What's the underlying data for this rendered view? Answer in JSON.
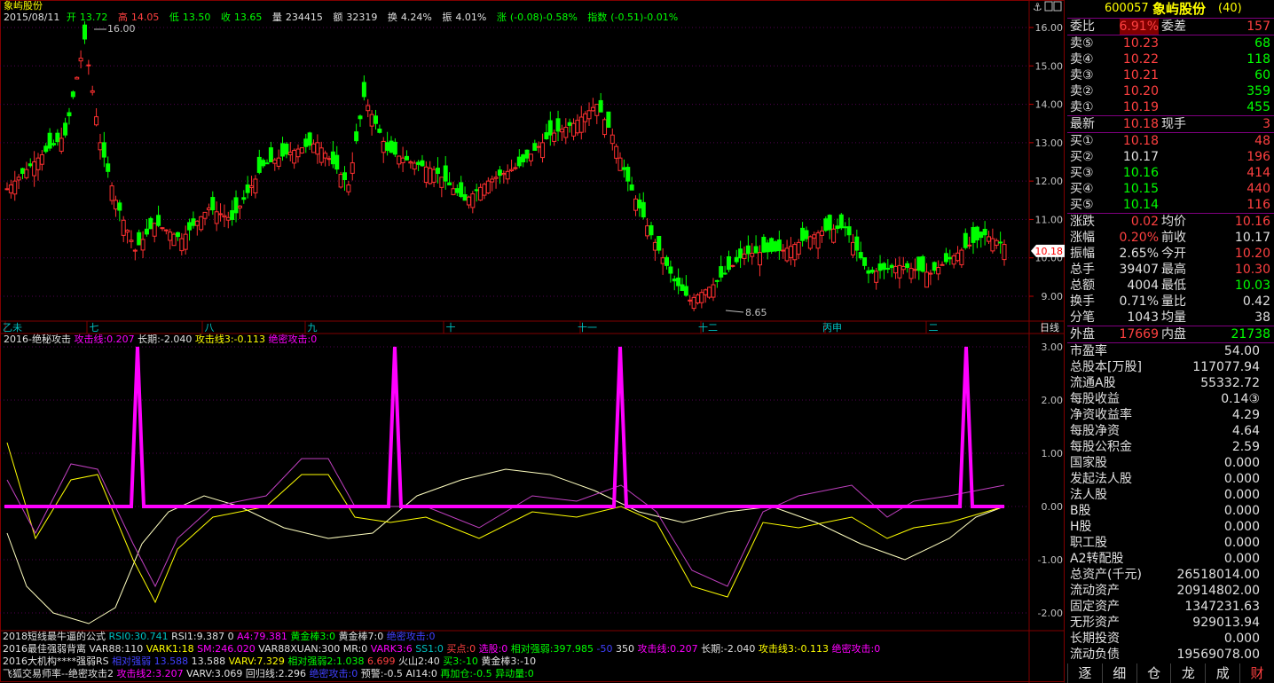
{
  "header": {
    "stock_name": "象屿股份",
    "date": "2015/08/11",
    "open_label": "开",
    "open": "13.72",
    "high_label": "高",
    "high": "14.05",
    "low_label": "低",
    "low": "13.50",
    "close_label": "收",
    "close": "13.65",
    "volume_label": "量",
    "volume": "234415",
    "amount_label": "额",
    "amount": "32319",
    "turnover_label": "换",
    "turnover": "4.24%",
    "amplitude_label": "振",
    "amplitude": "4.01%",
    "change_label": "涨",
    "change": "(-0.08)-0.58%",
    "index_label": "指数",
    "index": "(-0.51)-0.01%"
  },
  "price_axis": [
    "16.00",
    "15.00",
    "14.00",
    "13.00",
    "12.00",
    "11.00",
    "10.00",
    "9.00"
  ],
  "price_marks": {
    "high_mark": "16.00",
    "low_mark": "8.65",
    "current_tag": "10.18"
  },
  "month_labels": [
    "乙未",
    "七",
    "八",
    "九",
    "十",
    "十一",
    "十二",
    "丙申",
    "二",
    "日线"
  ],
  "indicator": {
    "title": "2016-绝秘攻击",
    "attack_line_label": "攻击线:0.207",
    "long_label": "长期:-2.040",
    "attack3_label": "攻击线3:-0.113",
    "secret_label": "绝密攻击:0",
    "axis": [
      "3.00",
      "2.00",
      "1.00",
      "0.00",
      "-1.00",
      "-2.00"
    ]
  },
  "bottom_rows": [
    {
      "name": "2018短线最牛逼的公式",
      "items": [
        "RSI0:30.741",
        "RSI1:9.387",
        "0",
        "A4:79.381",
        "黄金棒3:0",
        "黄金棒7:0",
        "绝密攻击:0"
      ]
    },
    {
      "name": "2016最佳强弱背离",
      "items": [
        "VAR88:110",
        "VARK1:18",
        "SM:246.020",
        "VAR88XUAN:300",
        "MR:0",
        "VARK3:6",
        "SS1:0",
        "买点:0",
        "选股:0",
        "相对强弱:397.985",
        "-50",
        "350",
        "攻击线:0.207",
        "长期:-2.040",
        "攻击线3:-0.113",
        "绝密攻击:0"
      ]
    },
    {
      "name": "2016大机构****强弱RS",
      "items": [
        "相对强弱 13.588",
        "13.588",
        "VARV:7.329",
        "相对强弱2:1.038",
        "6.699",
        "火山2:40",
        "买3:-10",
        "黄金棒3:-10"
      ]
    },
    {
      "name": "飞狐交易师率--绝密攻击2",
      "items": [
        "攻击线2:3.207",
        "VARV:3.069",
        "回归线:2.296",
        "绝密攻击:0",
        "预警:-0.5",
        "AI14:0",
        "再加仓:-0.5",
        "异动量:0"
      ]
    }
  ],
  "panel": {
    "code": "600057",
    "name": "象屿股份",
    "suffix": "(40)",
    "weibi_label": "委比",
    "weibi": "6.91%",
    "weicha_label": "委差",
    "weicha": "157",
    "asks": [
      {
        "label": "卖⑤",
        "price": "10.23",
        "vol": "68"
      },
      {
        "label": "卖④",
        "price": "10.22",
        "vol": "118"
      },
      {
        "label": "卖③",
        "price": "10.21",
        "vol": "60"
      },
      {
        "label": "卖②",
        "price": "10.20",
        "vol": "359"
      },
      {
        "label": "卖①",
        "price": "10.19",
        "vol": "455"
      }
    ],
    "latest_label": "最新",
    "latest": "10.18",
    "xianshou_label": "现手",
    "xianshou": "3",
    "bids": [
      {
        "label": "买①",
        "price": "10.18",
        "vol": "48"
      },
      {
        "label": "买②",
        "price": "10.17",
        "vol": "196"
      },
      {
        "label": "买③",
        "price": "10.16",
        "vol": "414"
      },
      {
        "label": "买④",
        "price": "10.15",
        "vol": "440"
      },
      {
        "label": "买⑤",
        "price": "10.14",
        "vol": "116"
      }
    ],
    "stats": [
      {
        "l1": "涨跌",
        "v1": "0.02",
        "l2": "均价",
        "v2": "10.16"
      },
      {
        "l1": "涨幅",
        "v1": "0.20%",
        "l2": "前收",
        "v2": "10.17"
      },
      {
        "l1": "振幅",
        "v1": "2.65%",
        "l2": "今开",
        "v2": "10.20"
      },
      {
        "l1": "总手",
        "v1": "39407",
        "l2": "最高",
        "v2": "10.30"
      },
      {
        "l1": "总额",
        "v1": "4004",
        "l2": "最低",
        "v2": "10.03"
      },
      {
        "l1": "换手",
        "v1": "0.71%",
        "l2": "量比",
        "v2": "0.42"
      },
      {
        "l1": "分笔",
        "v1": "1043",
        "l2": "均量",
        "v2": "38"
      }
    ],
    "outer_label": "外盘",
    "outer": "17669",
    "inner_label": "内盘",
    "inner": "21738",
    "fundamentals": [
      {
        "label": "市盈率",
        "value": "54.00"
      },
      {
        "label": "总股本[万股]",
        "value": "117077.94"
      },
      {
        "label": "流通A股",
        "value": "55332.72"
      },
      {
        "label": "每股收益",
        "value": "0.14③"
      },
      {
        "label": "净资收益率",
        "value": "4.29"
      },
      {
        "label": "每股净资",
        "value": "4.64"
      },
      {
        "label": "每股公积金",
        "value": "2.59"
      },
      {
        "label": "国家股",
        "value": "0.000"
      },
      {
        "label": "发起法人股",
        "value": "0.000"
      },
      {
        "label": "法人股",
        "value": "0.000"
      },
      {
        "label": "B股",
        "value": "0.000"
      },
      {
        "label": "H股",
        "value": "0.000"
      },
      {
        "label": "职工股",
        "value": "0.000"
      },
      {
        "label": "A2转配股",
        "value": "0.000"
      },
      {
        "label": "总资产(千元)",
        "value": "26518014.00"
      },
      {
        "label": "流动资产",
        "value": "20914802.00"
      },
      {
        "label": "固定资产",
        "value": "1347231.63"
      },
      {
        "label": "无形资产",
        "value": "929013.94"
      },
      {
        "label": "长期投资",
        "value": "0.000"
      },
      {
        "label": "流动负债",
        "value": "19569078.00"
      }
    ],
    "tabs": [
      "逐",
      "细",
      "仓",
      "龙",
      "成",
      "财"
    ]
  },
  "colors": {
    "up": "#ff3030",
    "down": "#00ff00",
    "axis": "#800000",
    "grid": "#600060",
    "attack": "#ff00ff",
    "white_line": "#ffffc0",
    "yellow_line": "#ffff00",
    "purple_line": "#c040c0"
  }
}
